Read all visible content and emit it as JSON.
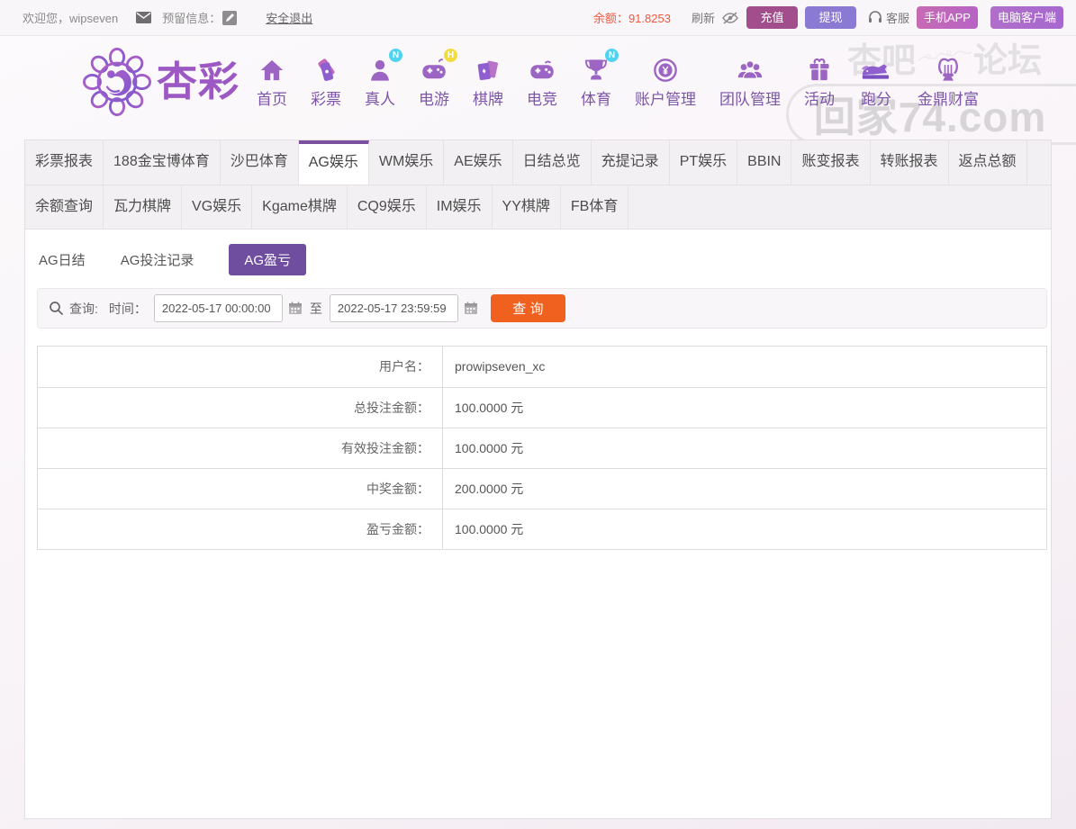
{
  "topbar": {
    "welcome": "欢迎您，wipseven",
    "reserved_label": "预留信息：",
    "logout": "安全退出",
    "balance_label": "余额：",
    "balance_value": "91.8253",
    "refresh": "刷新",
    "recharge": "充值",
    "withdraw": "提现",
    "service": "客服",
    "mobile_app": "手机APP",
    "pc_client": "电脑客户端"
  },
  "header": {
    "brand": "杏彩",
    "nav": [
      {
        "label": "首页",
        "icon": "home-icon"
      },
      {
        "label": "彩票",
        "icon": "ticket-icon"
      },
      {
        "label": "真人",
        "icon": "person-icon",
        "badge": "N"
      },
      {
        "label": "电游",
        "icon": "gamepad-icon",
        "badge": "H"
      },
      {
        "label": "棋牌",
        "icon": "cards-icon"
      },
      {
        "label": "电竞",
        "icon": "esports-icon"
      },
      {
        "label": "体育",
        "icon": "trophy-icon",
        "badge": "N"
      },
      {
        "label": "账户管理",
        "icon": "yen-coin-icon"
      },
      {
        "label": "团队管理",
        "icon": "team-icon"
      },
      {
        "label": "活动",
        "icon": "gift-icon"
      },
      {
        "label": "跑分",
        "icon": "runner-icon"
      },
      {
        "label": "金鼎财富",
        "icon": "harp-icon"
      }
    ],
    "watermark": {
      "left": "杏吧",
      "right": "论坛",
      "domain": "回家74.com"
    }
  },
  "tabs": {
    "active": "AG娱乐",
    "row1": [
      "彩票报表",
      "188金宝博体育",
      "沙巴体育",
      "AG娱乐",
      "WM娱乐",
      "AE娱乐",
      "日结总览",
      "充提记录",
      "PT娱乐",
      "BBIN",
      "账变报表",
      "转账报表",
      "返点总额"
    ],
    "row2": [
      "余额查询",
      "瓦力棋牌",
      "VG娱乐",
      "Kgame棋牌",
      "CQ9娱乐",
      "IM娱乐",
      "YY棋牌",
      "FB体育"
    ]
  },
  "subtabs": {
    "active": "AG盈亏",
    "items": [
      "AG日结",
      "AG投注记录",
      "AG盈亏"
    ]
  },
  "query": {
    "search_label": "查询:",
    "time_label": "时间：",
    "start_time": "2022-05-17 00:00:00",
    "to_label": "至",
    "end_time": "2022-05-17 23:59:59",
    "submit": "查 询"
  },
  "table": {
    "rows": [
      {
        "label": "用户名：",
        "value": "prowipseven_xc"
      },
      {
        "label": "总投注金额：",
        "value": "100.0000 元"
      },
      {
        "label": "有效投注金额：",
        "value": "100.0000 元"
      },
      {
        "label": "中奖金额：",
        "value": "200.0000 元"
      },
      {
        "label": "盈亏金额：",
        "value": "100.0000 元"
      }
    ]
  }
}
